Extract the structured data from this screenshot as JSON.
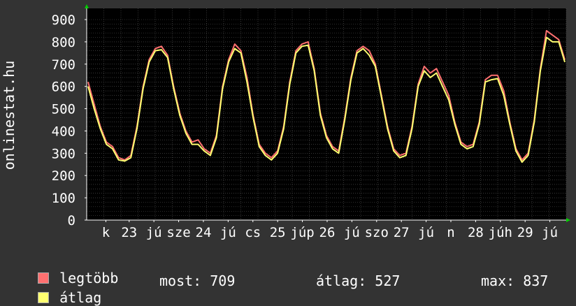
{
  "chart_data": {
    "type": "line",
    "ylabel": "onlinestat.hu",
    "ylim": [
      0,
      900
    ],
    "yticks": [
      0,
      100,
      200,
      300,
      400,
      500,
      600,
      700,
      800,
      900
    ],
    "xticks": [
      "k",
      "23",
      "jú",
      "sze",
      "24",
      "jú",
      "cs",
      "25",
      "júp",
      "26",
      "jú",
      "szo",
      "27",
      "jú",
      "n",
      "28",
      "júh",
      "29",
      "jú"
    ],
    "grid": true,
    "colors": {
      "max": "#ff7070",
      "avg": "#ffff70",
      "axis": "#ffffff",
      "arrow": "#00cc00",
      "grid": "#5a5a5a"
    },
    "series": [
      {
        "name": "legtöbb",
        "key": "max",
        "values": [
          620,
          520,
          420,
          350,
          330,
          280,
          270,
          290,
          420,
          600,
          720,
          770,
          780,
          740,
          600,
          480,
          400,
          350,
          360,
          320,
          300,
          380,
          600,
          720,
          790,
          760,
          640,
          470,
          340,
          300,
          280,
          310,
          420,
          620,
          760,
          790,
          800,
          680,
          480,
          380,
          330,
          310,
          460,
          640,
          760,
          780,
          760,
          700,
          560,
          420,
          320,
          290,
          300,
          420,
          610,
          690,
          660,
          680,
          620,
          560,
          440,
          350,
          330,
          340,
          440,
          630,
          650,
          650,
          580,
          440,
          320,
          270,
          300,
          450,
          680,
          850,
          830,
          810,
          720
        ]
      },
      {
        "name": "átlag",
        "key": "avg",
        "values": [
          600,
          500,
          410,
          340,
          320,
          270,
          265,
          280,
          410,
          590,
          710,
          760,
          765,
          730,
          590,
          470,
          390,
          340,
          340,
          310,
          290,
          370,
          590,
          710,
          770,
          750,
          620,
          460,
          330,
          290,
          270,
          300,
          410,
          610,
          750,
          780,
          785,
          670,
          470,
          370,
          320,
          300,
          450,
          630,
          750,
          770,
          740,
          690,
          550,
          410,
          310,
          280,
          290,
          410,
          600,
          670,
          640,
          660,
          600,
          540,
          430,
          340,
          320,
          330,
          430,
          620,
          630,
          635,
          560,
          430,
          310,
          260,
          290,
          440,
          670,
          820,
          800,
          800,
          709
        ]
      }
    ]
  },
  "legend": {
    "max_label": "legtöbb",
    "avg_label": "átlag"
  },
  "stats": {
    "now": "most: 709",
    "avg": "átlag: 527",
    "max": "max: 837"
  }
}
